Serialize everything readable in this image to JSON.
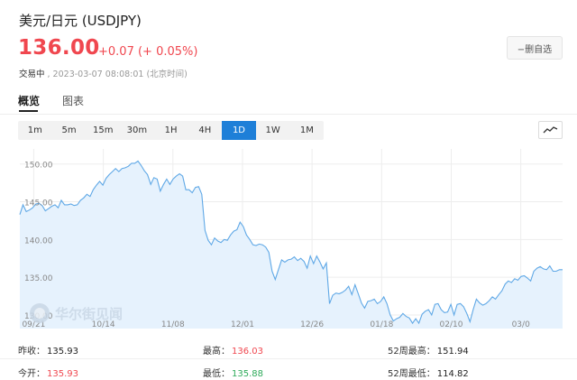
{
  "header": {
    "title": "美元/日元  (USDJPY)",
    "price": "136.00",
    "change": "+0.07 (+ 0.05%)",
    "status": "交易中",
    "timestamp": ", 2023-03-07 08:08:01 (北京时间)",
    "remove_button": "−删自选"
  },
  "tabs": [
    {
      "label": "概览",
      "active": true
    },
    {
      "label": "图表",
      "active": false
    }
  ],
  "periods": [
    "1m",
    "5m",
    "15m",
    "30m",
    "1H",
    "4H",
    "1D",
    "1W",
    "1M"
  ],
  "active_period": "1D",
  "watermark": "华尔街见闻",
  "stats": {
    "prev_close_label": "昨收：",
    "prev_close": "135.93",
    "open_label": "今开：",
    "open": "135.93",
    "high_label": "最高：",
    "high": "136.03",
    "low_label": "最低：",
    "low": "135.88",
    "w52_high_label": "52周最高：",
    "w52_high": "151.94",
    "w52_low_label": "52周最低：",
    "w52_low": "114.82"
  },
  "colors": {
    "up": "#f0474f",
    "down": "#2daa59",
    "accent": "#1e7fd8",
    "line": "#5fa8e6",
    "area": "#e6f2fd"
  },
  "chart_data": {
    "type": "area",
    "y_ticks": [
      "150.00",
      "145.00",
      "140.00",
      "135.00",
      "130.00"
    ],
    "x_ticks": [
      "09/21",
      "10/14",
      "11/08",
      "12/01",
      "12/26",
      "01/18",
      "02/10",
      "03/0"
    ],
    "ylim": [
      128.2,
      152.0
    ],
    "grid": true,
    "values": [
      143.3,
      144.6,
      143.7,
      143.9,
      144.2,
      144.7,
      144.8,
      144.5,
      143.8,
      144.1,
      144.4,
      144.6,
      144.2,
      145.2,
      144.6,
      144.6,
      144.7,
      144.5,
      144.6,
      145.2,
      145.5,
      146.0,
      145.7,
      146.6,
      147.2,
      147.7,
      147.2,
      148.1,
      148.6,
      149.0,
      149.4,
      149.0,
      149.4,
      149.5,
      149.7,
      150.1,
      150.1,
      150.4,
      149.8,
      149.1,
      148.6,
      147.3,
      148.2,
      148.0,
      146.4,
      147.3,
      148.0,
      147.3,
      148.0,
      148.4,
      148.7,
      148.4,
      146.6,
      146.6,
      146.2,
      146.9,
      147.0,
      146.0,
      141.2,
      139.9,
      139.3,
      140.2,
      139.8,
      139.6,
      140.0,
      139.9,
      140.6,
      141.1,
      141.3,
      142.3,
      141.7,
      140.6,
      140.0,
      139.3,
      139.2,
      139.4,
      139.3,
      139.0,
      138.3,
      135.8,
      134.7,
      136.0,
      137.3,
      137.0,
      137.3,
      137.4,
      137.7,
      137.2,
      137.5,
      137.1,
      136.2,
      137.8,
      136.8,
      137.8,
      137.0,
      136.1,
      136.9,
      131.5,
      132.6,
      132.9,
      132.8,
      133.0,
      133.3,
      133.8,
      132.7,
      134.0,
      132.8,
      131.6,
      130.9,
      131.8,
      131.9,
      132.1,
      131.5,
      131.8,
      132.4,
      131.5,
      130.0,
      129.2,
      129.5,
      129.7,
      130.2,
      129.8,
      129.6,
      128.9,
      129.5,
      128.9,
      130.1,
      130.5,
      130.7,
      130.0,
      131.4,
      131.5,
      130.7,
      130.3,
      130.4,
      131.4,
      130.0,
      131.4,
      131.5,
      131.1,
      130.2,
      129.1,
      130.7,
      132.1,
      131.6,
      131.3,
      131.5,
      131.9,
      132.4,
      132.1,
      132.7,
      133.2,
      134.1,
      134.5,
      134.3,
      134.8,
      134.6,
      135.1,
      135.2,
      134.9,
      134.5,
      135.8,
      136.2,
      136.4,
      136.1,
      136.0,
      136.5,
      135.8,
      135.8,
      136.0,
      136.0
    ]
  }
}
